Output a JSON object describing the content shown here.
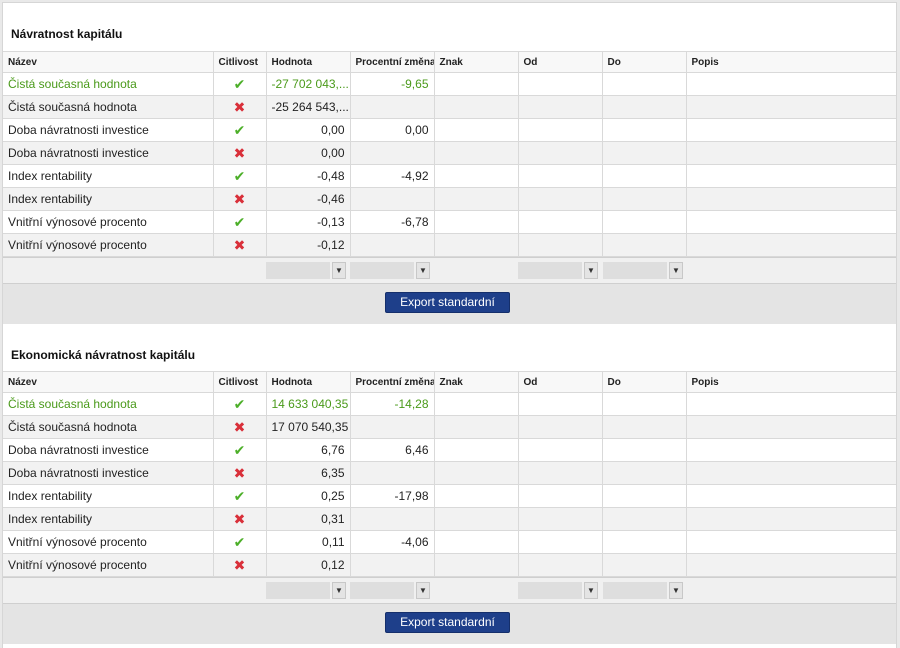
{
  "columns": [
    "Název",
    "Citlivost",
    "Hodnota",
    "Procentní změna",
    "Znak",
    "Od",
    "Do",
    "Popis"
  ],
  "export_label": "Export standardní",
  "sections": [
    {
      "title": "Návratnost kapitálu",
      "rows": [
        {
          "name": "Čistá současná hodnota",
          "sensitivity": "check",
          "value": "-27 702 043,...",
          "change": "-9,65",
          "highlight": true
        },
        {
          "name": "Čistá současná hodnota",
          "sensitivity": "cross",
          "value": "-25 264 543,...",
          "change": "",
          "highlight": false
        },
        {
          "name": "Doba návratnosti investice",
          "sensitivity": "check",
          "value": "0,00",
          "change": "0,00",
          "highlight": false
        },
        {
          "name": "Doba návratnosti investice",
          "sensitivity": "cross",
          "value": "0,00",
          "change": "",
          "highlight": false
        },
        {
          "name": "Index rentability",
          "sensitivity": "check",
          "value": "-0,48",
          "change": "-4,92",
          "highlight": false
        },
        {
          "name": "Index rentability",
          "sensitivity": "cross",
          "value": "-0,46",
          "change": "",
          "highlight": false
        },
        {
          "name": "Vnitřní výnosové procento",
          "sensitivity": "check",
          "value": "-0,13",
          "change": "-6,78",
          "highlight": false
        },
        {
          "name": "Vnitřní výnosové procento",
          "sensitivity": "cross",
          "value": "-0,12",
          "change": "",
          "highlight": false
        }
      ]
    },
    {
      "title": "Ekonomická návratnost kapitálu",
      "rows": [
        {
          "name": "Čistá současná hodnota",
          "sensitivity": "check",
          "value": "14 633 040,35",
          "change": "-14,28",
          "highlight": true
        },
        {
          "name": "Čistá současná hodnota",
          "sensitivity": "cross",
          "value": "17 070 540,35",
          "change": "",
          "highlight": false
        },
        {
          "name": "Doba návratnosti investice",
          "sensitivity": "check",
          "value": "6,76",
          "change": "6,46",
          "highlight": false
        },
        {
          "name": "Doba návratnosti investice",
          "sensitivity": "cross",
          "value": "6,35",
          "change": "",
          "highlight": false
        },
        {
          "name": "Index rentability",
          "sensitivity": "check",
          "value": "0,25",
          "change": "-17,98",
          "highlight": false
        },
        {
          "name": "Index rentability",
          "sensitivity": "cross",
          "value": "0,31",
          "change": "",
          "highlight": false
        },
        {
          "name": "Vnitřní výnosové procento",
          "sensitivity": "check",
          "value": "0,11",
          "change": "-4,06",
          "highlight": false
        },
        {
          "name": "Vnitřní výnosové procento",
          "sensitivity": "cross",
          "value": "0,12",
          "change": "",
          "highlight": false
        }
      ]
    }
  ],
  "colors": {
    "highlight_text": "#4a9a1a",
    "check": "#4caf28",
    "cross": "#d9303a",
    "button": "#1e3f8a"
  }
}
